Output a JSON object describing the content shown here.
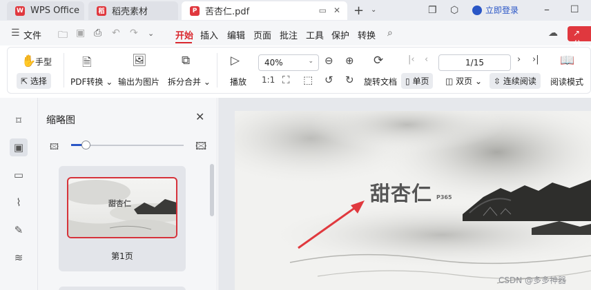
{
  "tabs": [
    {
      "label": "WPS Office",
      "color": "#e0383e"
    },
    {
      "label": "稻壳素材",
      "color": "#e0383e"
    },
    {
      "label": "苦杏仁.pdf",
      "color": "#e0383e"
    }
  ],
  "titlebar": {
    "login_label": "立即登录"
  },
  "menu": {
    "file_label": "文件",
    "items": [
      "开始",
      "插入",
      "编辑",
      "页面",
      "批注",
      "工具",
      "保护",
      "转换"
    ],
    "active": "开始",
    "share_label": "分"
  },
  "ribbon": {
    "hand_label": "手型",
    "select_label": "选择",
    "pdf_convert_label": "PDF转换",
    "export_image_label": "输出为图片",
    "split_merge_label": "拆分合并",
    "play_label": "播放",
    "zoom_value": "40%",
    "page_value": "1/15",
    "rotate_label": "旋转文档",
    "single_label": "单页",
    "double_label": "双页",
    "continuous_label": "连续阅读",
    "reading_mode_label": "阅读模式"
  },
  "thumbnail_panel": {
    "title": "缩略图",
    "thumb_text": "甜杏仁",
    "page_label": "第1页"
  },
  "document": {
    "title": "甜杏仁",
    "subtitle": "P365"
  },
  "watermark": "CSDN @多多神器",
  "colors": {
    "accent": "#d9272e",
    "link": "#2a56c6"
  }
}
